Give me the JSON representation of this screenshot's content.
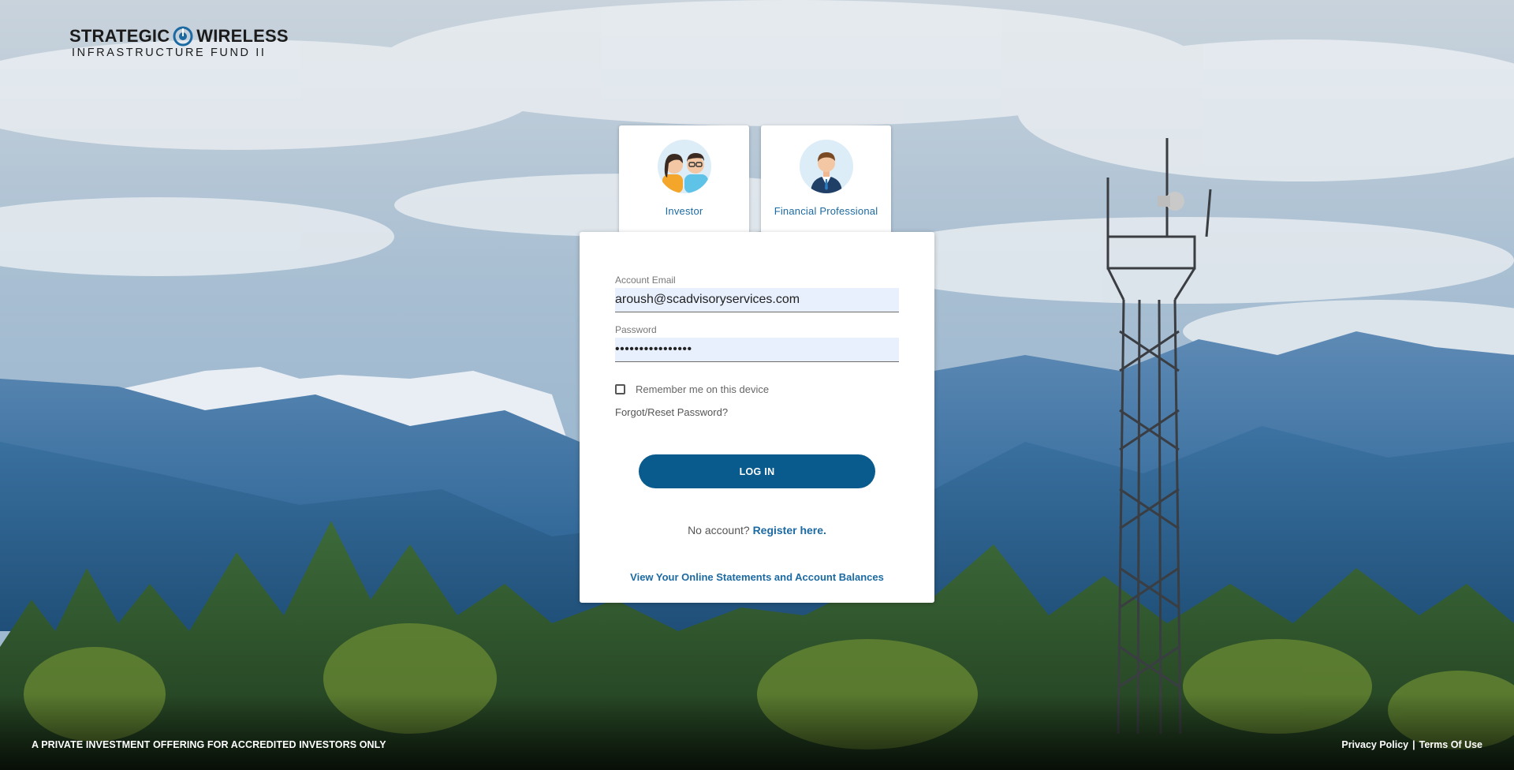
{
  "brand": {
    "line1_left": "STRATEGIC",
    "line1_right": "WIRELESS",
    "line2": "INFRASTRUCTURE FUND II"
  },
  "roles": [
    {
      "label": "Investor",
      "icon": "investor-couple-avatar-icon",
      "selected": false
    },
    {
      "label": "Financial Professional",
      "icon": "businessman-avatar-icon",
      "selected": true
    }
  ],
  "form": {
    "email_label": "Account Email",
    "email_value": "aroush@scadvisoryservices.com",
    "password_label": "Password",
    "password_value": "••••••••••••••••",
    "remember_label": "Remember me on this device",
    "remember_checked": false,
    "forgot_label": "Forgot/Reset Password?",
    "login_label": "LOG IN",
    "no_account_text": "No account?",
    "register_label": "Register here.",
    "statements_label": "View Your Online Statements and Account Balances"
  },
  "footer": {
    "disclaimer": "A PRIVATE INVESTMENT OFFERING FOR ACCREDITED INVESTORS ONLY",
    "privacy_label": "Privacy Policy",
    "separator": "|",
    "terms_label": "Terms Of Use"
  },
  "colors": {
    "primary": "#0a5b8d",
    "link": "#1c6aa2",
    "check": "#4a9c3f",
    "input_bg": "#e8f0fe"
  }
}
